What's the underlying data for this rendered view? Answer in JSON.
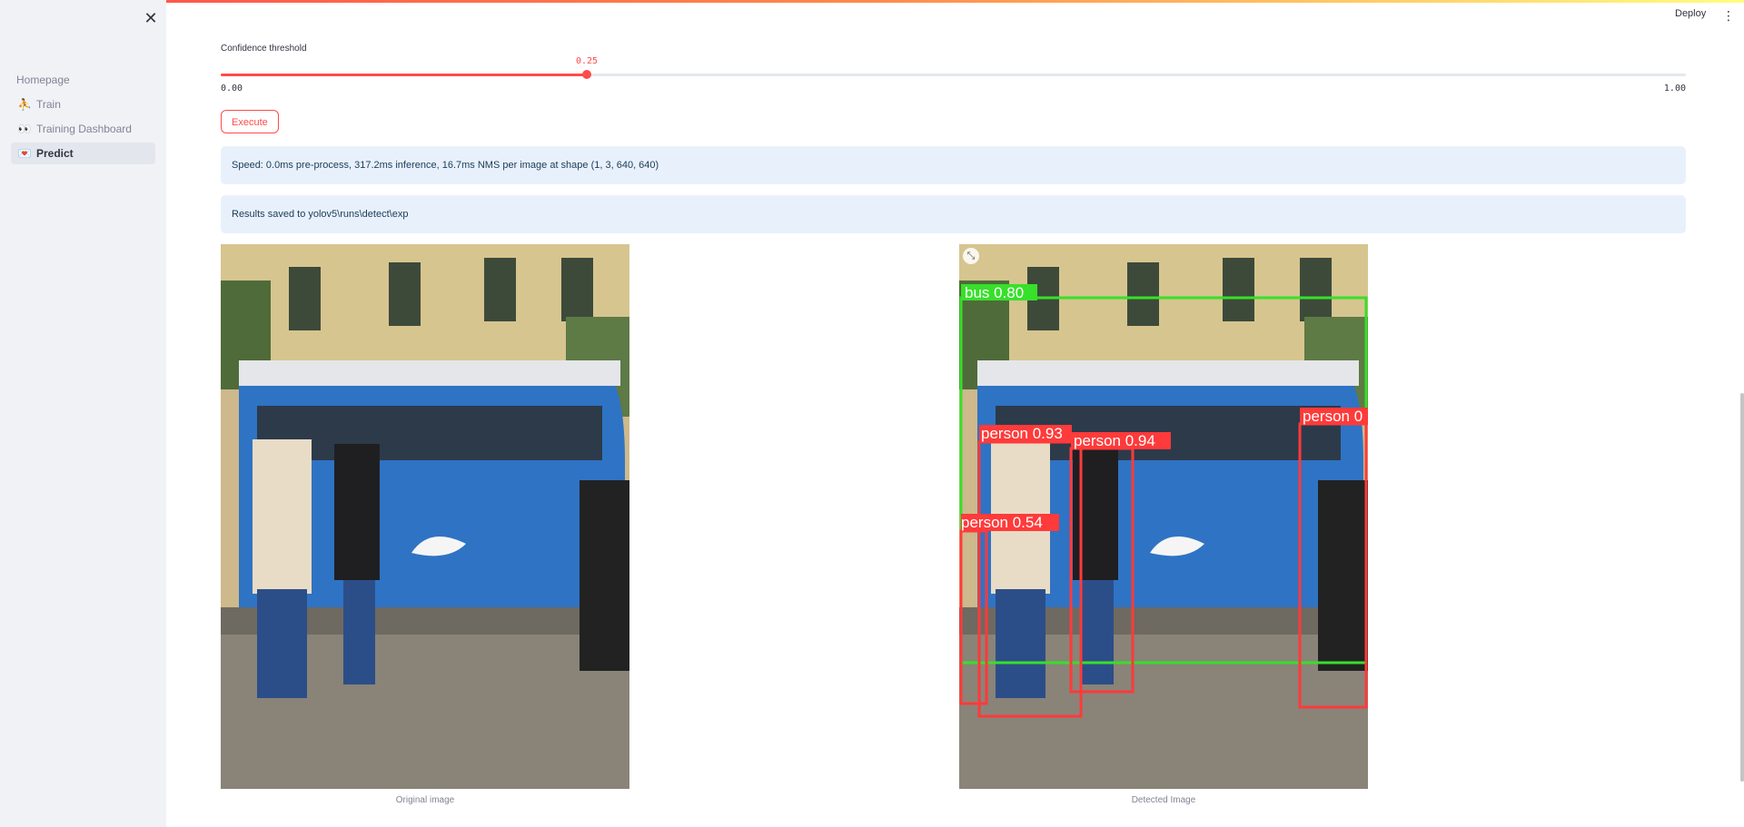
{
  "sidebar": {
    "close_label": "✕",
    "items": [
      {
        "label": "Homepage",
        "emoji": ""
      },
      {
        "label": "Train",
        "emoji": "⛹"
      },
      {
        "label": "Training Dashboard",
        "emoji": "👀"
      },
      {
        "label": "Predict",
        "emoji": "💌"
      }
    ]
  },
  "header": {
    "deploy_label": "Deploy",
    "menu_icon": "⋮"
  },
  "slider": {
    "label": "Confidence threshold",
    "value": "0.25",
    "min": "0.00",
    "max": "1.00",
    "fraction": 0.25
  },
  "execute_label": "Execute",
  "messages": {
    "speed": "Speed: 0.0ms pre-process, 317.2ms inference, 16.7ms NMS per image at shape (1, 3, 640, 640)",
    "saved": "Results saved to yolov5\\runs\\detect\\exp"
  },
  "images": {
    "original_caption": "Original image",
    "detected_caption": "Detected Image",
    "expand_icon": "⤡"
  },
  "detections": [
    {
      "label": "bus 0.80",
      "color": "#37e02a"
    },
    {
      "label": "person 0.93",
      "color": "#ff3a3a"
    },
    {
      "label": "person 0.94",
      "color": "#ff3a3a"
    },
    {
      "label": "person 0.54",
      "color": "#ff3a3a"
    },
    {
      "label": "person 0",
      "color": "#ff3a3a"
    }
  ],
  "colors": {
    "accent": "#ff4b4b",
    "info_bg": "#e8f1fb",
    "sidebar_bg": "#f0f2f6"
  }
}
